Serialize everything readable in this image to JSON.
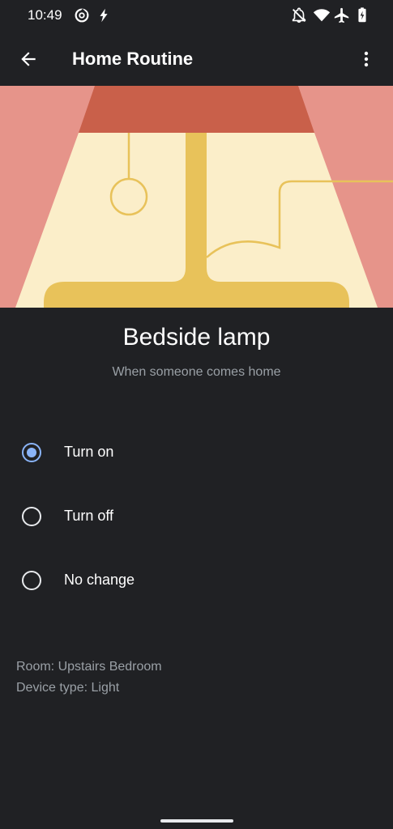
{
  "status_bar": {
    "time": "10:49",
    "left_icons": [
      "data-saver-icon",
      "flash-icon"
    ],
    "right_icons": [
      "notifications-off-icon",
      "wifi-icon",
      "airplane-icon",
      "battery-icon"
    ]
  },
  "app_bar": {
    "title": "Home Routine",
    "back_icon": "arrow-back-icon",
    "menu_icon": "more-vert-icon"
  },
  "device": {
    "name": "Bedside lamp",
    "subtitle": "When someone comes home"
  },
  "options": [
    {
      "label": "Turn on",
      "selected": true
    },
    {
      "label": "Turn off",
      "selected": false
    },
    {
      "label": "No change",
      "selected": false
    }
  ],
  "meta": {
    "room": "Room: Upstairs Bedroom",
    "device_type": "Device type: Light"
  },
  "colors": {
    "background": "#202124",
    "accent": "#8ab4f8",
    "secondary_text": "#9aa0a6",
    "illustration_pink": "#e6948a",
    "illustration_shade": "#c9604a",
    "illustration_cream": "#fbeec9",
    "illustration_gold": "#e8c25a"
  }
}
